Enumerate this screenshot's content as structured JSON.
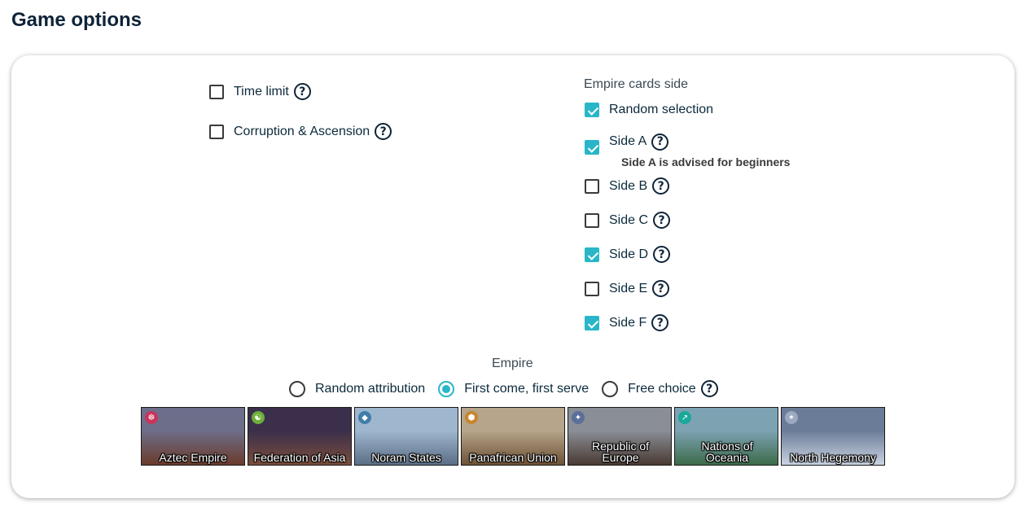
{
  "page": {
    "title": "Game options"
  },
  "left_options": [
    {
      "label": "Time limit",
      "checked": false,
      "help": "?"
    },
    {
      "label": "Corruption & Ascension",
      "checked": false,
      "help": "?"
    }
  ],
  "cards_side": {
    "label": "Empire cards side",
    "random": {
      "label": "Random selection",
      "checked": true
    },
    "sides": [
      {
        "label": "Side A",
        "checked": true,
        "help": "?"
      },
      {
        "label": "Side B",
        "checked": false,
        "help": "?"
      },
      {
        "label": "Side C",
        "checked": false,
        "help": "?"
      },
      {
        "label": "Side D",
        "checked": true,
        "help": "?"
      },
      {
        "label": "Side E",
        "checked": false,
        "help": "?"
      },
      {
        "label": "Side F",
        "checked": true,
        "help": "?"
      }
    ],
    "side_a_hint": "Side A is advised for beginners"
  },
  "empire": {
    "label": "Empire",
    "modes": [
      {
        "label": "Random attribution",
        "selected": false
      },
      {
        "label": "First come, first serve",
        "selected": true
      },
      {
        "label": "Free choice",
        "selected": false,
        "help": "?"
      }
    ],
    "cards": [
      {
        "name": "Aztec Empire",
        "emblem": "☸",
        "emblem_color": "#c9345c",
        "sky": "#6d6e8a",
        "ground": "#6b3b2b"
      },
      {
        "name": "Federation of Asia",
        "emblem": "☯",
        "emblem_color": "#6cae3a",
        "sky": "#3b2f4c",
        "ground": "#7a4d3a"
      },
      {
        "name": "Noram States",
        "emblem": "◆",
        "emblem_color": "#3f7ea8",
        "sky": "#9fb6cf",
        "ground": "#5b6f86"
      },
      {
        "name": "Panafrican Union",
        "emblem": "⬢",
        "emblem_color": "#c7862d",
        "sky": "#b6a58a",
        "ground": "#6e5236"
      },
      {
        "name": "Republic of Europe",
        "emblem": "✦",
        "emblem_color": "#5a6f9a",
        "sky": "#8a8e96",
        "ground": "#4a3a33"
      },
      {
        "name": "Nations of Oceania",
        "emblem": "↗",
        "emblem_color": "#1aa89a",
        "sky": "#7da2b2",
        "ground": "#3c6b4a"
      },
      {
        "name": "North Hegemony",
        "emblem": "✶",
        "emblem_color": "#9aa8c0",
        "sky": "#6b7c98",
        "ground": "#c9d3e2"
      }
    ]
  }
}
